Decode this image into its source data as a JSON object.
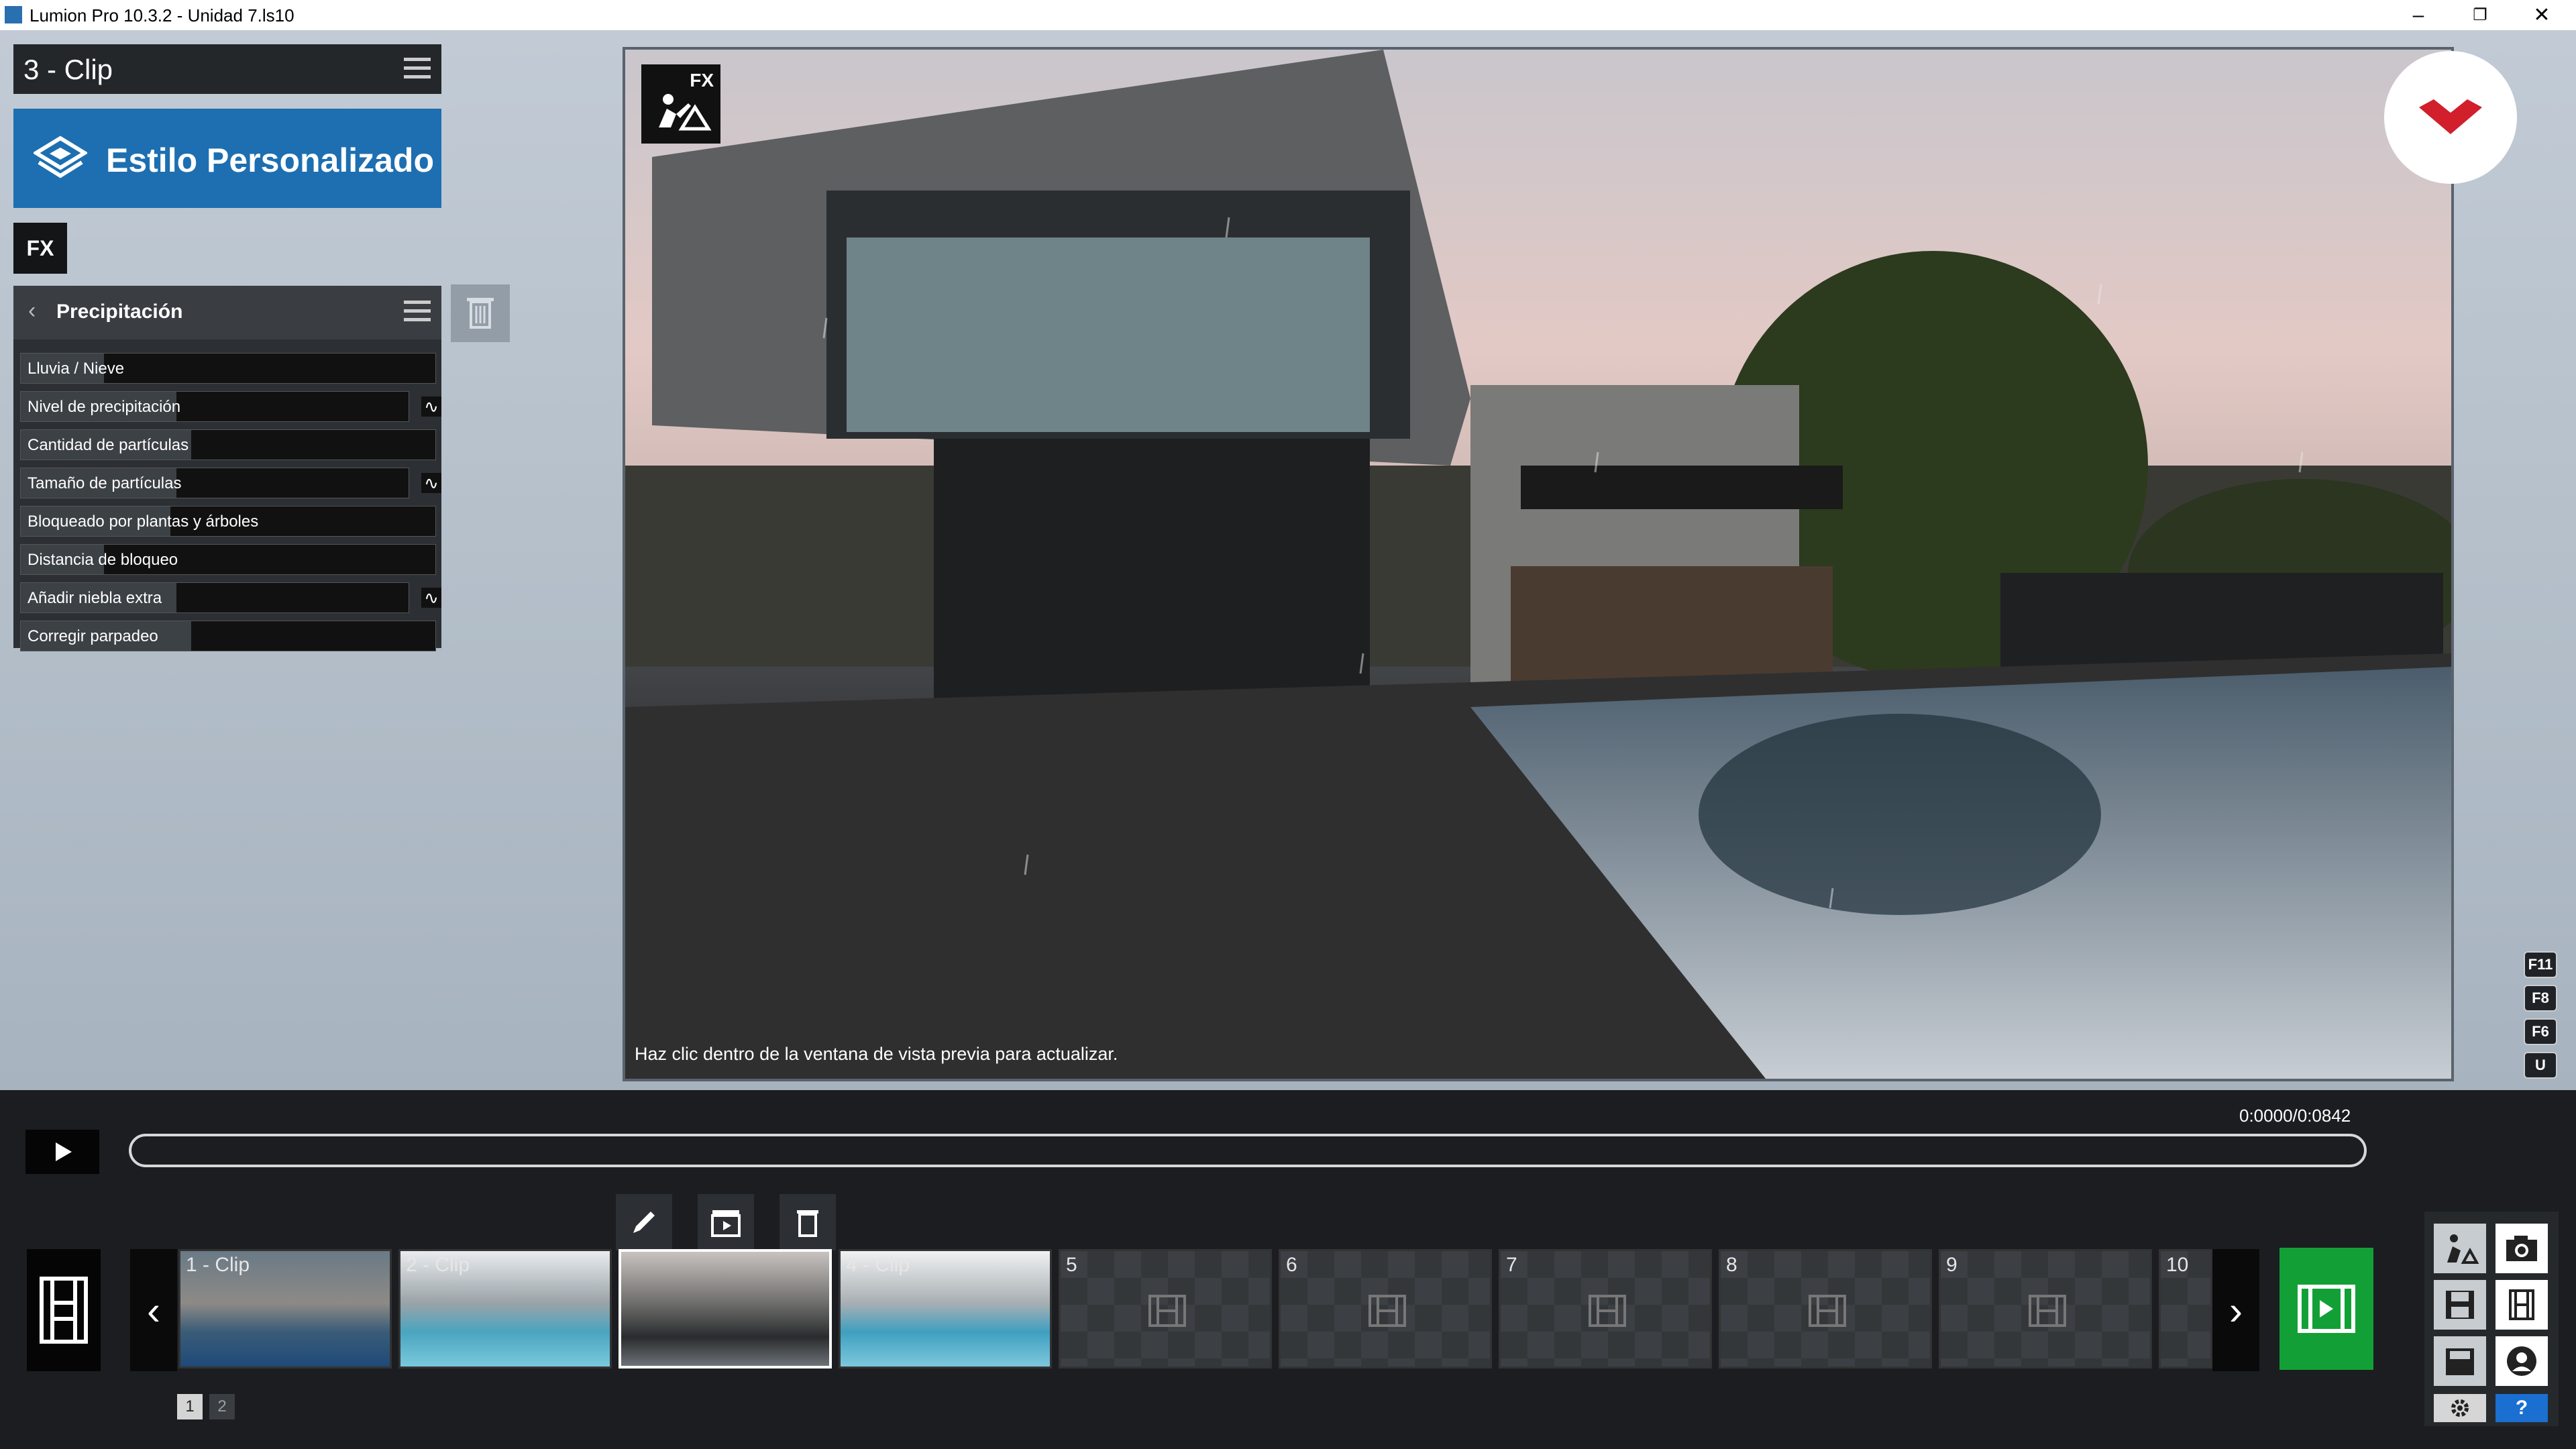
{
  "window": {
    "title": "Lumion Pro 10.3.2  - Unidad 7.ls10",
    "controls": {
      "minimize": "–",
      "restore": "❐",
      "close": "✕"
    }
  },
  "left_panel": {
    "clip_title": "3 - Clip",
    "style_label": "Estilo Personalizado",
    "fx_label": "FX",
    "effect": {
      "title": "Precipitación",
      "rows": [
        {
          "label": "Lluvia / Nieve",
          "level": 0.0,
          "curve": false
        },
        {
          "label": "Nivel de precipitación",
          "level": 0.2,
          "curve": true
        },
        {
          "label": "Cantidad de partículas",
          "level": 0.21,
          "curve": false
        },
        {
          "label": "Tamaño de partículas",
          "level": 0.2,
          "curve": true
        },
        {
          "label": "Bloqueado por plantas y árboles",
          "level": 0.16,
          "curve": false
        },
        {
          "label": "Distancia de bloqueo",
          "level": 0.0,
          "curve": false
        },
        {
          "label": "Añadir niebla extra",
          "level": 0.2,
          "curve": true
        },
        {
          "label": "Corregir parpadeo",
          "level": 0.21,
          "curve": false
        }
      ],
      "curve_symbol": "∿"
    }
  },
  "preview": {
    "fx_badge": "FX",
    "message": "Haz clic dentro de la ventana de vista previa para actualizar.",
    "shortcuts": [
      "F11",
      "F8",
      "F6",
      "U"
    ]
  },
  "timeline": {
    "time": "0:0000/0:0842",
    "progress": 0.0
  },
  "clips": {
    "slots": [
      {
        "label": "1 - Clip",
        "kind": "thumb"
      },
      {
        "label": "2 - Clip",
        "kind": "thumb"
      },
      {
        "label": "",
        "kind": "thumb",
        "selected": true
      },
      {
        "label": "4 - Clip",
        "kind": "thumb"
      },
      {
        "label": "5",
        "kind": "empty"
      },
      {
        "label": "6",
        "kind": "empty"
      },
      {
        "label": "7",
        "kind": "empty"
      },
      {
        "label": "8",
        "kind": "empty"
      },
      {
        "label": "9",
        "kind": "empty"
      },
      {
        "label": "10",
        "kind": "empty"
      }
    ],
    "pages": [
      "1",
      "2"
    ],
    "nav_prev": "‹",
    "nav_next": "›"
  },
  "dock": {
    "help": "?"
  },
  "colors": {
    "accent": "#1d6fb1",
    "render_button": "#12a036",
    "brand_red": "#d11f2c"
  }
}
